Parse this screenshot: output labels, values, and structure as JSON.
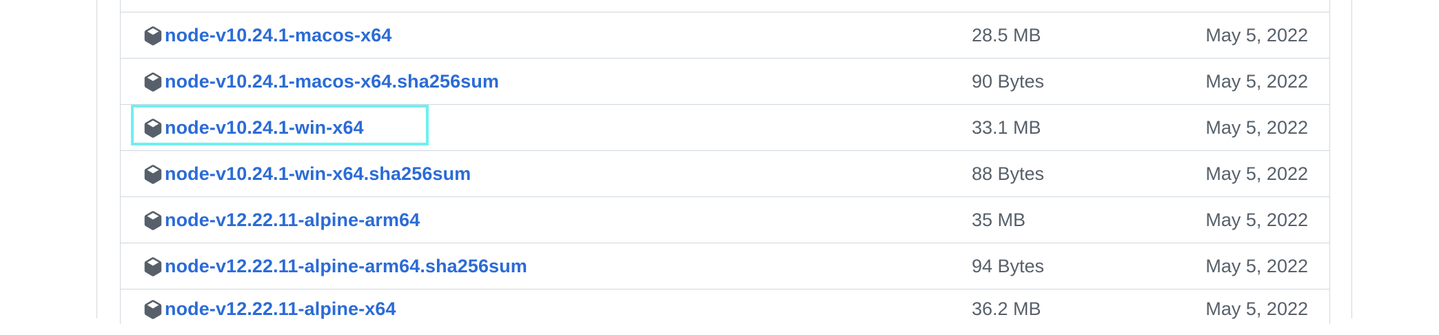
{
  "accent_color": "#2b6bd6",
  "muted_color": "#57606a",
  "highlight_color": "#6ef0f0",
  "assets": [
    {
      "name": "node-v10.24.1-macos-x64",
      "size": "28.5 MB",
      "date": "May 5, 2022",
      "icon": "package-icon"
    },
    {
      "name": "node-v10.24.1-macos-x64.sha256sum",
      "size": "90 Bytes",
      "date": "May 5, 2022",
      "icon": "package-icon"
    },
    {
      "name": "node-v10.24.1-win-x64",
      "size": "33.1 MB",
      "date": "May 5, 2022",
      "icon": "package-icon",
      "highlighted": true
    },
    {
      "name": "node-v10.24.1-win-x64.sha256sum",
      "size": "88 Bytes",
      "date": "May 5, 2022",
      "icon": "package-icon"
    },
    {
      "name": "node-v12.22.11-alpine-arm64",
      "size": "35 MB",
      "date": "May 5, 2022",
      "icon": "package-icon"
    },
    {
      "name": "node-v12.22.11-alpine-arm64.sha256sum",
      "size": "94 Bytes",
      "date": "May 5, 2022",
      "icon": "package-icon"
    },
    {
      "name": "node-v12.22.11-alpine-x64",
      "size": "36.2 MB",
      "date": "May 5, 2022",
      "icon": "package-icon"
    }
  ]
}
